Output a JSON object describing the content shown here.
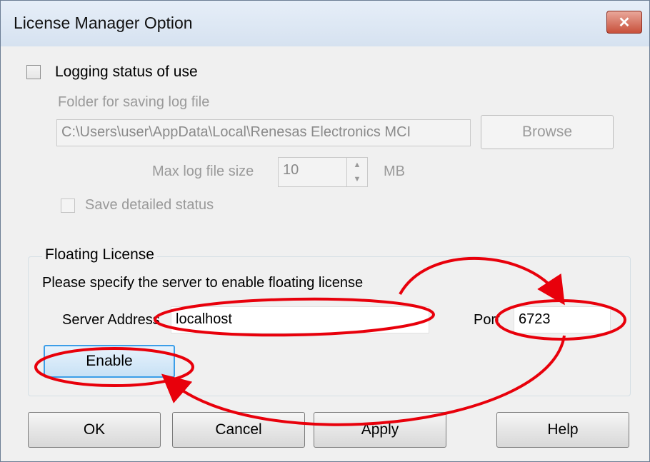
{
  "window": {
    "title": "License Manager Option",
    "close_glyph": "✕"
  },
  "logging": {
    "checkbox_label": "Logging status of use",
    "checked": false,
    "folder_label": "Folder for saving log file",
    "folder_value": "C:\\Users\\user\\AppData\\Local\\Renesas Electronics MCI",
    "browse_label": "Browse",
    "max_size_label": "Max log file size",
    "max_size_value": "10",
    "max_size_unit": "MB",
    "detailed_label": "Save detailed status",
    "detailed_checked": false
  },
  "floating": {
    "group_title": "Floating License",
    "description": "Please specify the server to enable floating license",
    "server_label": "Server Address",
    "server_value": "localhost",
    "port_label": "Port",
    "port_value": "6723",
    "enable_label": "Enable"
  },
  "footer": {
    "ok_label": "OK",
    "cancel_label": "Cancel",
    "apply_label": "Apply",
    "help_label": "Help"
  },
  "annotation": {
    "color": "#e8000b"
  },
  "icons": {
    "close": "close-icon",
    "spin_up": "spin-up-icon",
    "spin_down": "spin-down-icon"
  }
}
